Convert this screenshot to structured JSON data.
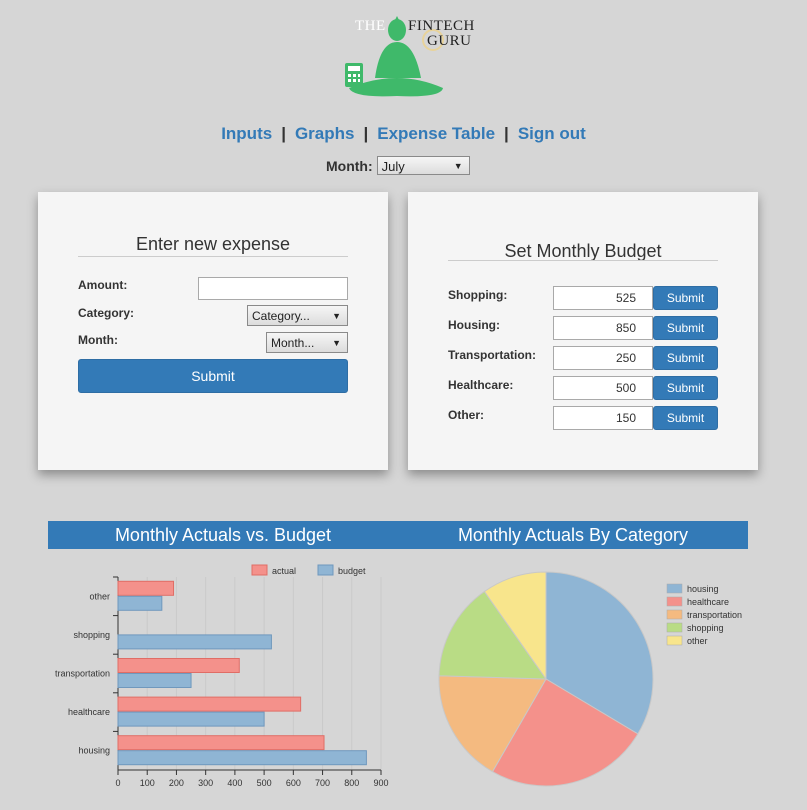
{
  "logo": {
    "line1": "THE",
    "line2": "FINTECH",
    "line3": "GURU"
  },
  "nav": {
    "items": [
      "Inputs",
      "Graphs",
      "Expense Table",
      "Sign out"
    ],
    "separator": "|"
  },
  "month_selector": {
    "label": "Month:",
    "value": "July"
  },
  "expense_panel": {
    "title": "Enter new expense",
    "amount_label": "Amount:",
    "amount_value": "",
    "category_label": "Category:",
    "category_value": "Category...",
    "month_label": "Month:",
    "month_value": "Month...",
    "submit_label": "Submit"
  },
  "budget_panel": {
    "title": "Set Monthly Budget",
    "rows": [
      {
        "label": "Shopping:",
        "value": "525",
        "button": "Submit"
      },
      {
        "label": "Housing:",
        "value": "850",
        "button": "Submit"
      },
      {
        "label": "Transportation:",
        "value": "250",
        "button": "Submit"
      },
      {
        "label": "Healthcare:",
        "value": "500",
        "button": "Submit"
      },
      {
        "label": "Other:",
        "value": "150",
        "button": "Submit"
      }
    ]
  },
  "colors": {
    "accent": "#337ab7",
    "actual": "#f4918b",
    "budget": "#8fb5d4",
    "healthcare": "#f4918b",
    "transportation": "#f4ba80",
    "shopping": "#b9dc85",
    "other": "#f8e58c",
    "housing": "#8fb5d4"
  },
  "chart_data": [
    {
      "type": "bar",
      "orientation": "horizontal",
      "title": "Monthly Actuals vs. Budget",
      "categories": [
        "other",
        "shopping",
        "transportation",
        "healthcare",
        "housing"
      ],
      "series": [
        {
          "name": "actual",
          "values": [
            190,
            0,
            415,
            625,
            705
          ]
        },
        {
          "name": "budget",
          "values": [
            150,
            525,
            250,
            500,
            850
          ]
        }
      ],
      "xlim": [
        0,
        900
      ],
      "xticks": [
        "0",
        "100",
        "200",
        "300",
        "400",
        "500",
        "600",
        "700",
        "800",
        "900"
      ],
      "legend": "top-right",
      "grid": true
    },
    {
      "type": "pie",
      "title": "Monthly Actuals By Category",
      "labels": [
        "housing",
        "healthcare",
        "transportation",
        "shopping",
        "other"
      ],
      "values": [
        705,
        520,
        360,
        310,
        205
      ],
      "legend": "right"
    }
  ]
}
